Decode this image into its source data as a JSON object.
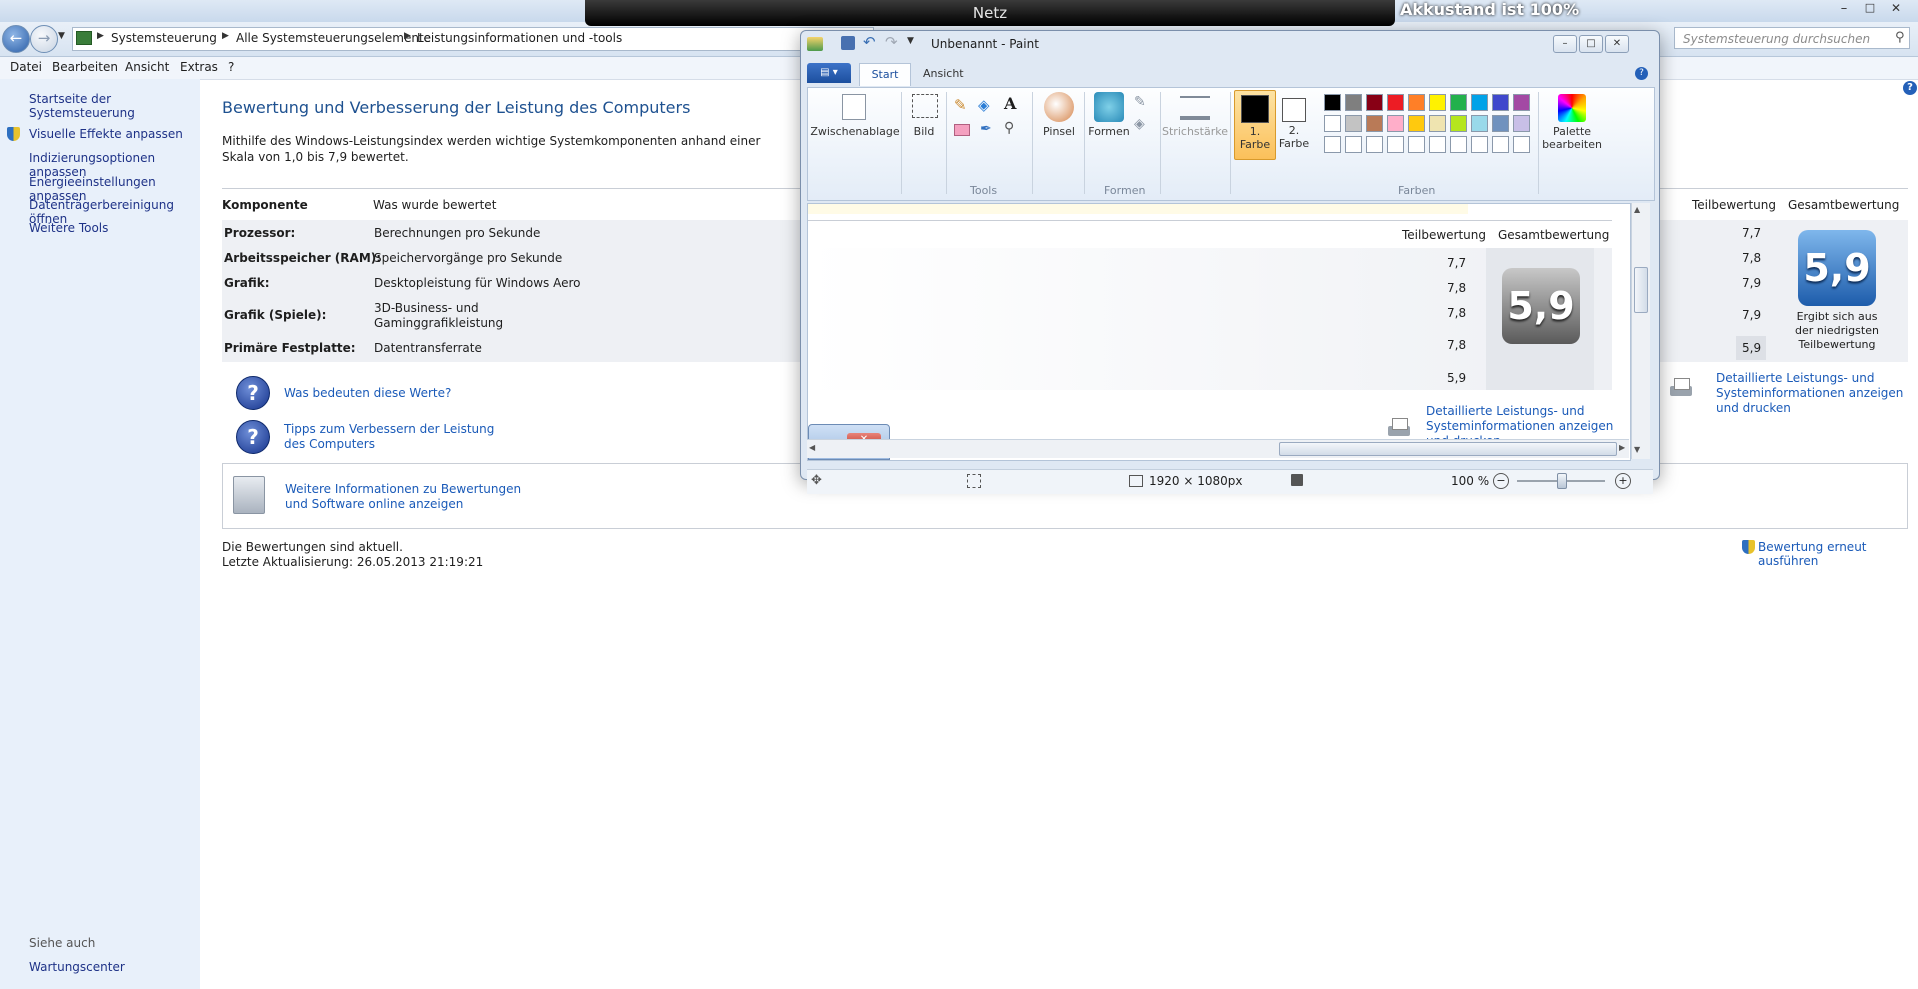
{
  "overlay": {
    "netz": "Netz",
    "akku": "Akkustand ist 100%"
  },
  "address": {
    "crumbs": [
      "Systemsteuerung",
      "Alle Systemsteuerungselemente",
      "Leistungsinformationen und -tools"
    ],
    "search_placeholder": "Systemsteuerung durchsuchen"
  },
  "menu": [
    "Datei",
    "Bearbeiten",
    "Ansicht",
    "Extras",
    "?"
  ],
  "sidebar": {
    "items": [
      "Startseite der Systemsteuerung",
      "Visuelle Effekte anpassen",
      "Indizierungsoptionen anpassen",
      "Energieeinstellungen anpassen",
      "Datenträgerbereinigung öffnen",
      "Weitere Tools"
    ],
    "see_also_title": "Siehe auch",
    "see_also_items": [
      "Wartungscenter"
    ]
  },
  "main": {
    "title": "Bewertung und Verbesserung der Leistung des Computers",
    "intro": "Mithilfe des Windows-Leistungsindex werden wichtige Systemkomponenten anhand einer Skala von 1,0 bis 7,9 bewertet.",
    "col_component": "Komponente",
    "col_rated": "Was wurde bewertet",
    "col_sub": "Teilbewertung",
    "col_total": "Gesamtbewertung",
    "rows": [
      {
        "component": "Prozessor:",
        "rated": "Berechnungen pro Sekunde",
        "score": "7,7"
      },
      {
        "component": "Arbeitsspeicher (RAM):",
        "rated": "Speichervorgänge pro Sekunde",
        "score": "7,8"
      },
      {
        "component": "Grafik:",
        "rated": "Desktopleistung für Windows Aero",
        "score": "7,9"
      },
      {
        "component": "Grafik (Spiele):",
        "rated": "3D-Business- und Gaminggrafikleistung",
        "score": "7,9"
      },
      {
        "component": "Primäre Festplatte:",
        "rated": "Datentransferrate",
        "score": "5,9"
      }
    ],
    "total_score": "5,9",
    "total_caption": "Ergibt sich aus der niedrigsten Teilbewertung",
    "details_link": "Detaillierte Leistungs- und Systeminformationen anzeigen und drucken",
    "help1": "Was bedeuten diese Werte?",
    "help2": "Tipps zum Verbessern der Leistung des Computers",
    "more_info": "Weitere Informationen zu Bewertungen und Software online anzeigen",
    "status1": "Die Bewertungen sind aktuell.",
    "status2": "Letzte Aktualisierung: 26.05.2013 21:19:21",
    "rerun": "Bewertung erneut ausführen"
  },
  "paint": {
    "title": "Unbenannt - Paint",
    "tabs": [
      "Start",
      "Ansicht"
    ],
    "groups": {
      "clipboard": "Zwischenablage",
      "image": "Bild",
      "tools": "Tools",
      "brushes": "Pinsel",
      "shapes": "Formen",
      "stroke": "Strichstärke",
      "color1": "1. Farbe",
      "color2": "2. Farbe",
      "colors_group": "Farben",
      "palette": "Palette bearbeiten",
      "shapes_group": "Formen"
    },
    "palette_row1": [
      "#000000",
      "#7f7f7f",
      "#880015",
      "#ed1c24",
      "#ff7f27",
      "#fff200",
      "#22b14c",
      "#00a2e8",
      "#3f48cc",
      "#a349a4"
    ],
    "palette_row2": [
      "#ffffff",
      "#c3c3c3",
      "#b97a57",
      "#ffaec9",
      "#ffc90e",
      "#efe4b0",
      "#b5e61d",
      "#99d9ea",
      "#7092be",
      "#c8bfe7"
    ],
    "canvas": {
      "col_sub": "Teilbewertung",
      "col_total": "Gesamtbewertung",
      "scores": [
        "7,7",
        "7,8",
        "7,8",
        "7,8",
        "5,9"
      ],
      "total_score": "5,9",
      "details_link": "Detaillierte Leistungs- und Systeminformationen anzeigen und drucken"
    },
    "status": {
      "size": "1920 × 1080px",
      "zoom": "100 %"
    }
  }
}
